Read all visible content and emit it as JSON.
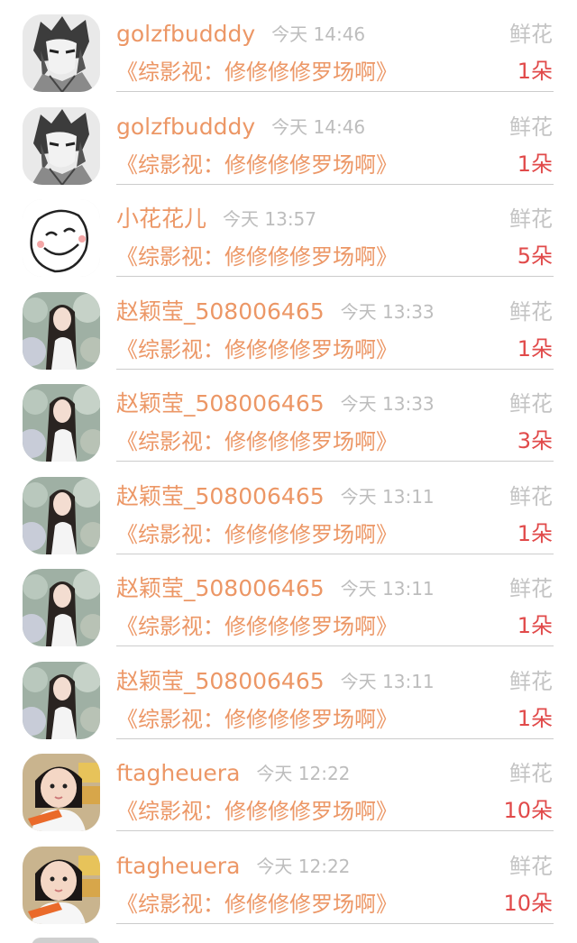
{
  "gift_records": [
    {
      "name": "golzfbudddy",
      "time": "今天 14:46",
      "gift": "鲜花",
      "book": "《综影视：修修修修罗场啊》",
      "count": "1朵",
      "avatar_icon": "anime-boy-avatar-icon"
    },
    {
      "name": "golzfbudddy",
      "time": "今天 14:46",
      "gift": "鲜花",
      "book": "《综影视：修修修修罗场啊》",
      "count": "1朵",
      "avatar_icon": "anime-boy-avatar-icon"
    },
    {
      "name": "小花花儿",
      "time": "今天 13:57",
      "gift": "鲜花",
      "book": "《综影视：修修修修罗场啊》",
      "count": "5朵",
      "avatar_icon": "smiley-doodle-avatar-icon"
    },
    {
      "name": "赵颖莹_508006465",
      "time": "今天 13:33",
      "gift": "鲜花",
      "book": "《综影视：修修修修罗场啊》",
      "count": "1朵",
      "avatar_icon": "woman-photo-avatar-icon"
    },
    {
      "name": "赵颖莹_508006465",
      "time": "今天 13:33",
      "gift": "鲜花",
      "book": "《综影视：修修修修罗场啊》",
      "count": "3朵",
      "avatar_icon": "woman-photo-avatar-icon"
    },
    {
      "name": "赵颖莹_508006465",
      "time": "今天 13:11",
      "gift": "鲜花",
      "book": "《综影视：修修修修罗场啊》",
      "count": "1朵",
      "avatar_icon": "woman-photo-avatar-icon"
    },
    {
      "name": "赵颖莹_508006465",
      "time": "今天 13:11",
      "gift": "鲜花",
      "book": "《综影视：修修修修罗场啊》",
      "count": "1朵",
      "avatar_icon": "woman-photo-avatar-icon"
    },
    {
      "name": "赵颖莹_508006465",
      "time": "今天 13:11",
      "gift": "鲜花",
      "book": "《综影视：修修修修罗场啊》",
      "count": "1朵",
      "avatar_icon": "woman-photo-avatar-icon"
    },
    {
      "name": "ftagheuera",
      "time": "今天 12:22",
      "gift": "鲜花",
      "book": "《综影视：修修修修罗场啊》",
      "count": "10朵",
      "avatar_icon": "child-photo-avatar-icon"
    },
    {
      "name": "ftagheuera",
      "time": "今天 12:22",
      "gift": "鲜花",
      "book": "《综影视：修修修修罗场啊》",
      "count": "10朵",
      "avatar_icon": "child-photo-avatar-icon"
    }
  ],
  "colors": {
    "name": "#ec9766",
    "time": "#bdbdbd",
    "gift_type": "#c4c4c4",
    "count": "#e14a4a",
    "divider": "#cccccc"
  }
}
